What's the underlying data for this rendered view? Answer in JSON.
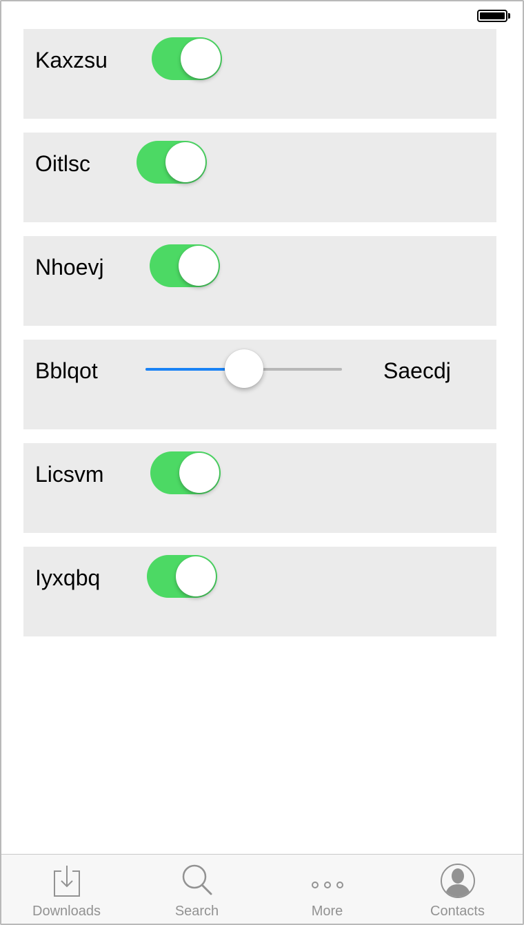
{
  "status_bar": {
    "battery_icon": "battery-full-icon"
  },
  "rows": [
    {
      "type": "toggle",
      "label": "Kaxzsu",
      "on": true
    },
    {
      "type": "toggle",
      "label": "Oitlsc",
      "on": true
    },
    {
      "type": "toggle",
      "label": "Nhoevj",
      "on": true
    },
    {
      "type": "slider",
      "label": "Bblqot",
      "right_label": "Saecdj",
      "value": 0.5
    },
    {
      "type": "toggle",
      "label": "Licsvm",
      "on": true
    },
    {
      "type": "toggle",
      "label": "Iyxqbq",
      "on": true
    }
  ],
  "tab_bar": {
    "tabs": [
      {
        "label": "Downloads",
        "icon": "downloads-icon"
      },
      {
        "label": "Search",
        "icon": "search-icon"
      },
      {
        "label": "More",
        "icon": "more-icon"
      },
      {
        "label": "Contacts",
        "icon": "contacts-icon"
      }
    ]
  },
  "colors": {
    "toggle_on": "#4cd964",
    "slider_fill": "#1a82f5",
    "row_background": "#ebebeb",
    "tab_label": "#929292"
  }
}
